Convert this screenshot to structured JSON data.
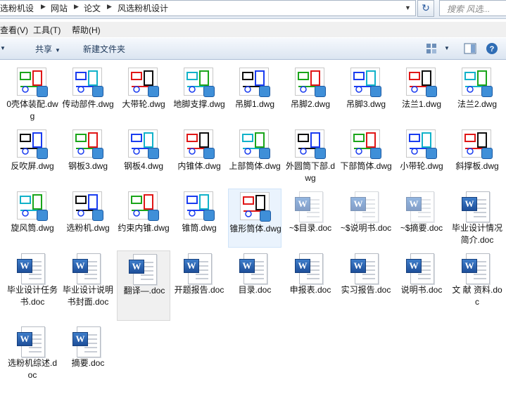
{
  "address": {
    "crumbs": [
      "选粉机设",
      "网站",
      "论文",
      "风选粉机设计"
    ],
    "search_placeholder": "搜索 风选..."
  },
  "menu": [
    "查看(V)",
    "工具(T)",
    "帮助(H)"
  ],
  "toolbar": {
    "share": "共享",
    "new_folder": "新建文件夹"
  },
  "files": [
    {
      "name": "0壳体装配.dwg",
      "type": "dwg"
    },
    {
      "name": "传动部件.dwg",
      "type": "dwg"
    },
    {
      "name": "大带轮.dwg",
      "type": "dwg"
    },
    {
      "name": "地脚支撑.dwg",
      "type": "dwg"
    },
    {
      "name": "吊脚1.dwg",
      "type": "dwg"
    },
    {
      "name": "吊脚2.dwg",
      "type": "dwg"
    },
    {
      "name": "吊脚3.dwg",
      "type": "dwg"
    },
    {
      "name": "法兰1.dwg",
      "type": "dwg"
    },
    {
      "name": "法兰2.dwg",
      "type": "dwg"
    },
    {
      "name": "反吹屏.dwg",
      "type": "dwg"
    },
    {
      "name": "钢板3.dwg",
      "type": "dwg"
    },
    {
      "name": "钢板4.dwg",
      "type": "dwg"
    },
    {
      "name": "内锥体.dwg",
      "type": "dwg"
    },
    {
      "name": "上部筒体.dwg",
      "type": "dwg"
    },
    {
      "name": "外圆筒下部.dwg",
      "type": "dwg"
    },
    {
      "name": "下部筒体.dwg",
      "type": "dwg"
    },
    {
      "name": "小带轮.dwg",
      "type": "dwg"
    },
    {
      "name": "斜撑板.dwg",
      "type": "dwg"
    },
    {
      "name": "旋风筒.dwg",
      "type": "dwg"
    },
    {
      "name": "选粉机.dwg",
      "type": "dwg"
    },
    {
      "name": "约束内锥.dwg",
      "type": "dwg"
    },
    {
      "name": "锥筒.dwg",
      "type": "dwg"
    },
    {
      "name": "锥形筒体.dwg",
      "type": "dwg",
      "state": "hover"
    },
    {
      "name": "~$目录.doc",
      "type": "doc",
      "faded": true
    },
    {
      "name": "~$说明书.doc",
      "type": "doc",
      "faded": true
    },
    {
      "name": "~$摘要.doc",
      "type": "doc",
      "faded": true
    },
    {
      "name": "毕业设计情况简介.doc",
      "type": "doc"
    },
    {
      "name": "毕业设计任务书.doc",
      "type": "doc"
    },
    {
      "name": "毕业设计说明书封面.doc",
      "type": "doc"
    },
    {
      "name": "翻译—.doc",
      "type": "doc",
      "state": "selected"
    },
    {
      "name": "开题报告.doc",
      "type": "doc"
    },
    {
      "name": "目录.doc",
      "type": "doc"
    },
    {
      "name": "申报表.doc",
      "type": "doc"
    },
    {
      "name": "实习报告.doc",
      "type": "doc"
    },
    {
      "name": "说明书.doc",
      "type": "doc"
    },
    {
      "name": "文 献 资料.doc",
      "type": "doc"
    },
    {
      "name": "选粉机综述.doc",
      "type": "doc"
    },
    {
      "name": "摘要.doc",
      "type": "doc"
    }
  ]
}
